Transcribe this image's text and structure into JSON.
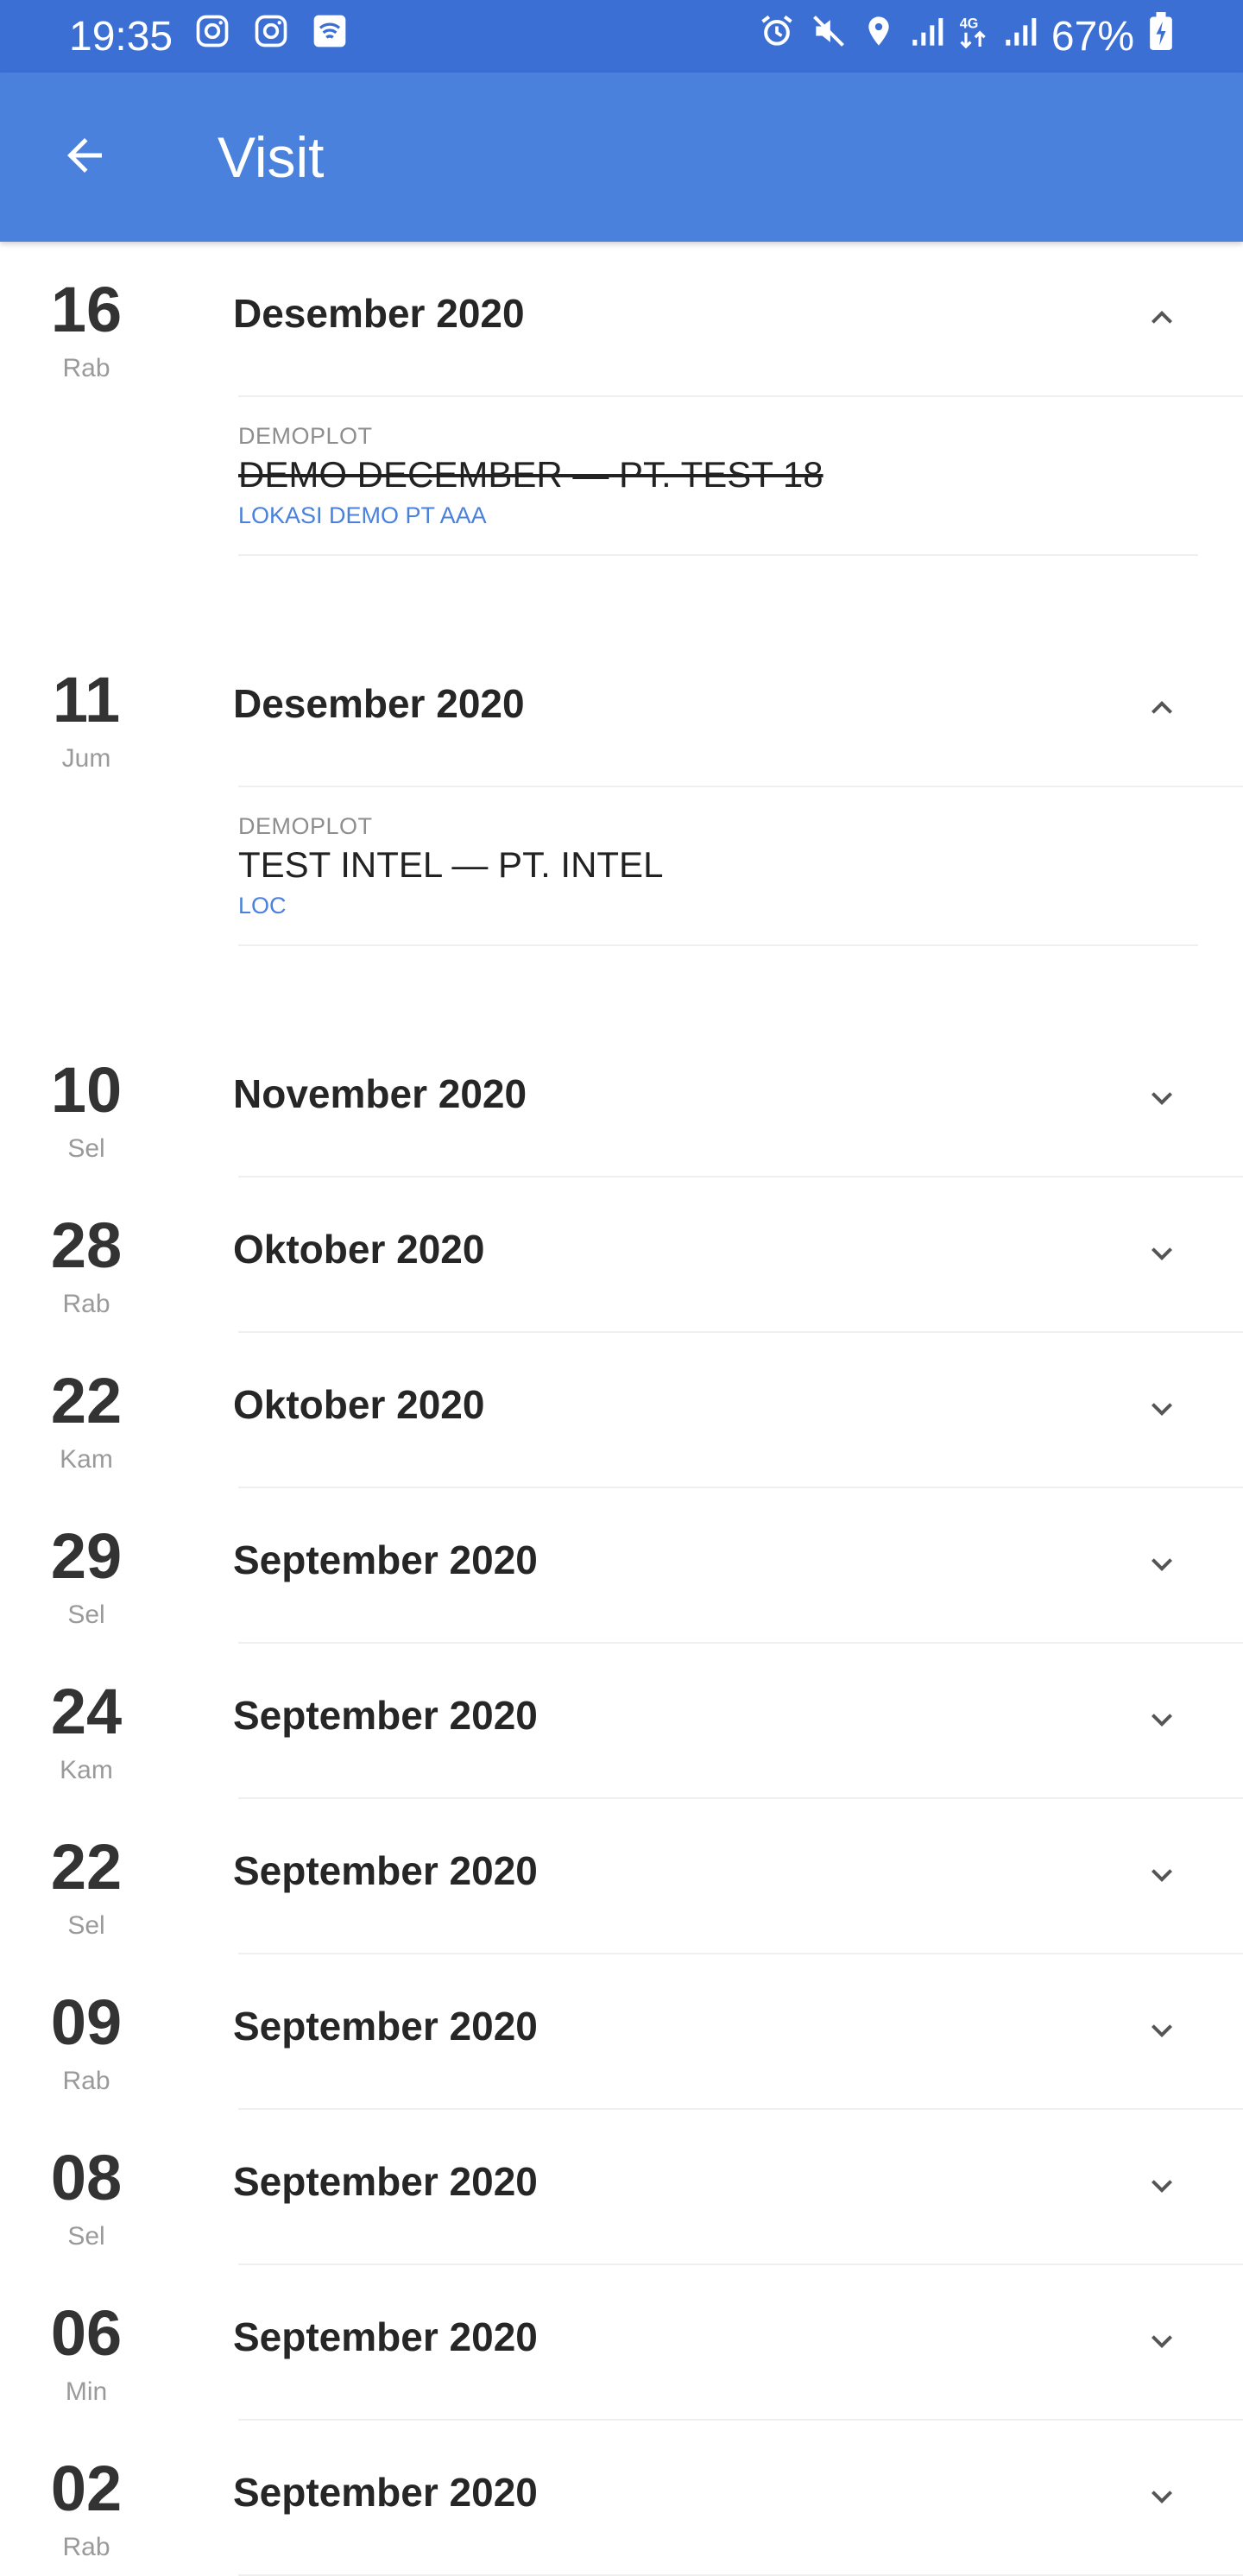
{
  "status_bar": {
    "time": "19:35",
    "battery": "67%",
    "left_icons": [
      "instagram-icon",
      "instagram-icon",
      "wifi-calling-icon"
    ],
    "right_icons": [
      "alarm-icon",
      "mute-icon",
      "location-icon",
      "signal-icon",
      "4g-icon",
      "signal-icon",
      "battery-charging-icon"
    ]
  },
  "app_bar": {
    "title": "Visit",
    "back_icon": "arrow-left-icon",
    "color": "#4a81dc"
  },
  "groups": [
    {
      "day": "16",
      "weekday": "Rab",
      "month": "Desember 2020",
      "expanded": true,
      "visits": [
        {
          "type": "DEMOPLOT",
          "title": "DEMO DECEMBER — PT. TEST 18",
          "location": "LOKASI DEMO PT AAA",
          "struck": true
        }
      ]
    },
    {
      "day": "11",
      "weekday": "Jum",
      "month": "Desember 2020",
      "expanded": true,
      "visits": [
        {
          "type": "DEMOPLOT",
          "title": "TEST INTEL — PT. INTEL",
          "location": "LOC",
          "struck": false
        }
      ]
    },
    {
      "day": "10",
      "weekday": "Sel",
      "month": "November 2020",
      "expanded": false,
      "visits": []
    },
    {
      "day": "28",
      "weekday": "Rab",
      "month": "Oktober 2020",
      "expanded": false,
      "visits": []
    },
    {
      "day": "22",
      "weekday": "Kam",
      "month": "Oktober 2020",
      "expanded": false,
      "visits": []
    },
    {
      "day": "29",
      "weekday": "Sel",
      "month": "September 2020",
      "expanded": false,
      "visits": []
    },
    {
      "day": "24",
      "weekday": "Kam",
      "month": "September 2020",
      "expanded": false,
      "visits": []
    },
    {
      "day": "22",
      "weekday": "Sel",
      "month": "September 2020",
      "expanded": false,
      "visits": []
    },
    {
      "day": "09",
      "weekday": "Rab",
      "month": "September 2020",
      "expanded": false,
      "visits": []
    },
    {
      "day": "08",
      "weekday": "Sel",
      "month": "September 2020",
      "expanded": false,
      "visits": []
    },
    {
      "day": "06",
      "weekday": "Min",
      "month": "September 2020",
      "expanded": false,
      "visits": []
    },
    {
      "day": "02",
      "weekday": "Rab",
      "month": "September 2020",
      "expanded": false,
      "visits": []
    }
  ]
}
